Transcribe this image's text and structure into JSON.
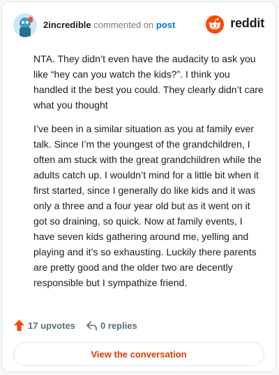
{
  "header": {
    "username": "2incredible",
    "action_text": "commented on",
    "post_link": "post",
    "brand": "reddit",
    "brand_color": "#ff4500"
  },
  "comment": {
    "paragraphs": [
      "NTA. They didn’t even have the audacity to ask you like “hey can you watch the kids?”. I think you handled it the best you could. They clearly didn’t care what you thought",
      "I’ve been in a similar situation as you at family ever talk. Since I’m the youngest of the grandchildren, I often am stuck with the great grandchildren while the adults catch up. I wouldn’t mind for a little bit when it first started, since I generally do like kids and it was only a three and a four year old but as it went on it got so draining, so quick. Now at family events, I have seven kids gathering around me, yelling and playing and it’s so exhausting. Luckily there parents are pretty good and the older two are decently responsible but I sympathize friend."
    ]
  },
  "actions": {
    "upvotes": "17 upvotes",
    "replies": "0 replies",
    "upvote_icon": "upvote-arrow-icon",
    "reply_icon": "reply-arrow-icon"
  },
  "cta": {
    "label": "View the conversation"
  }
}
